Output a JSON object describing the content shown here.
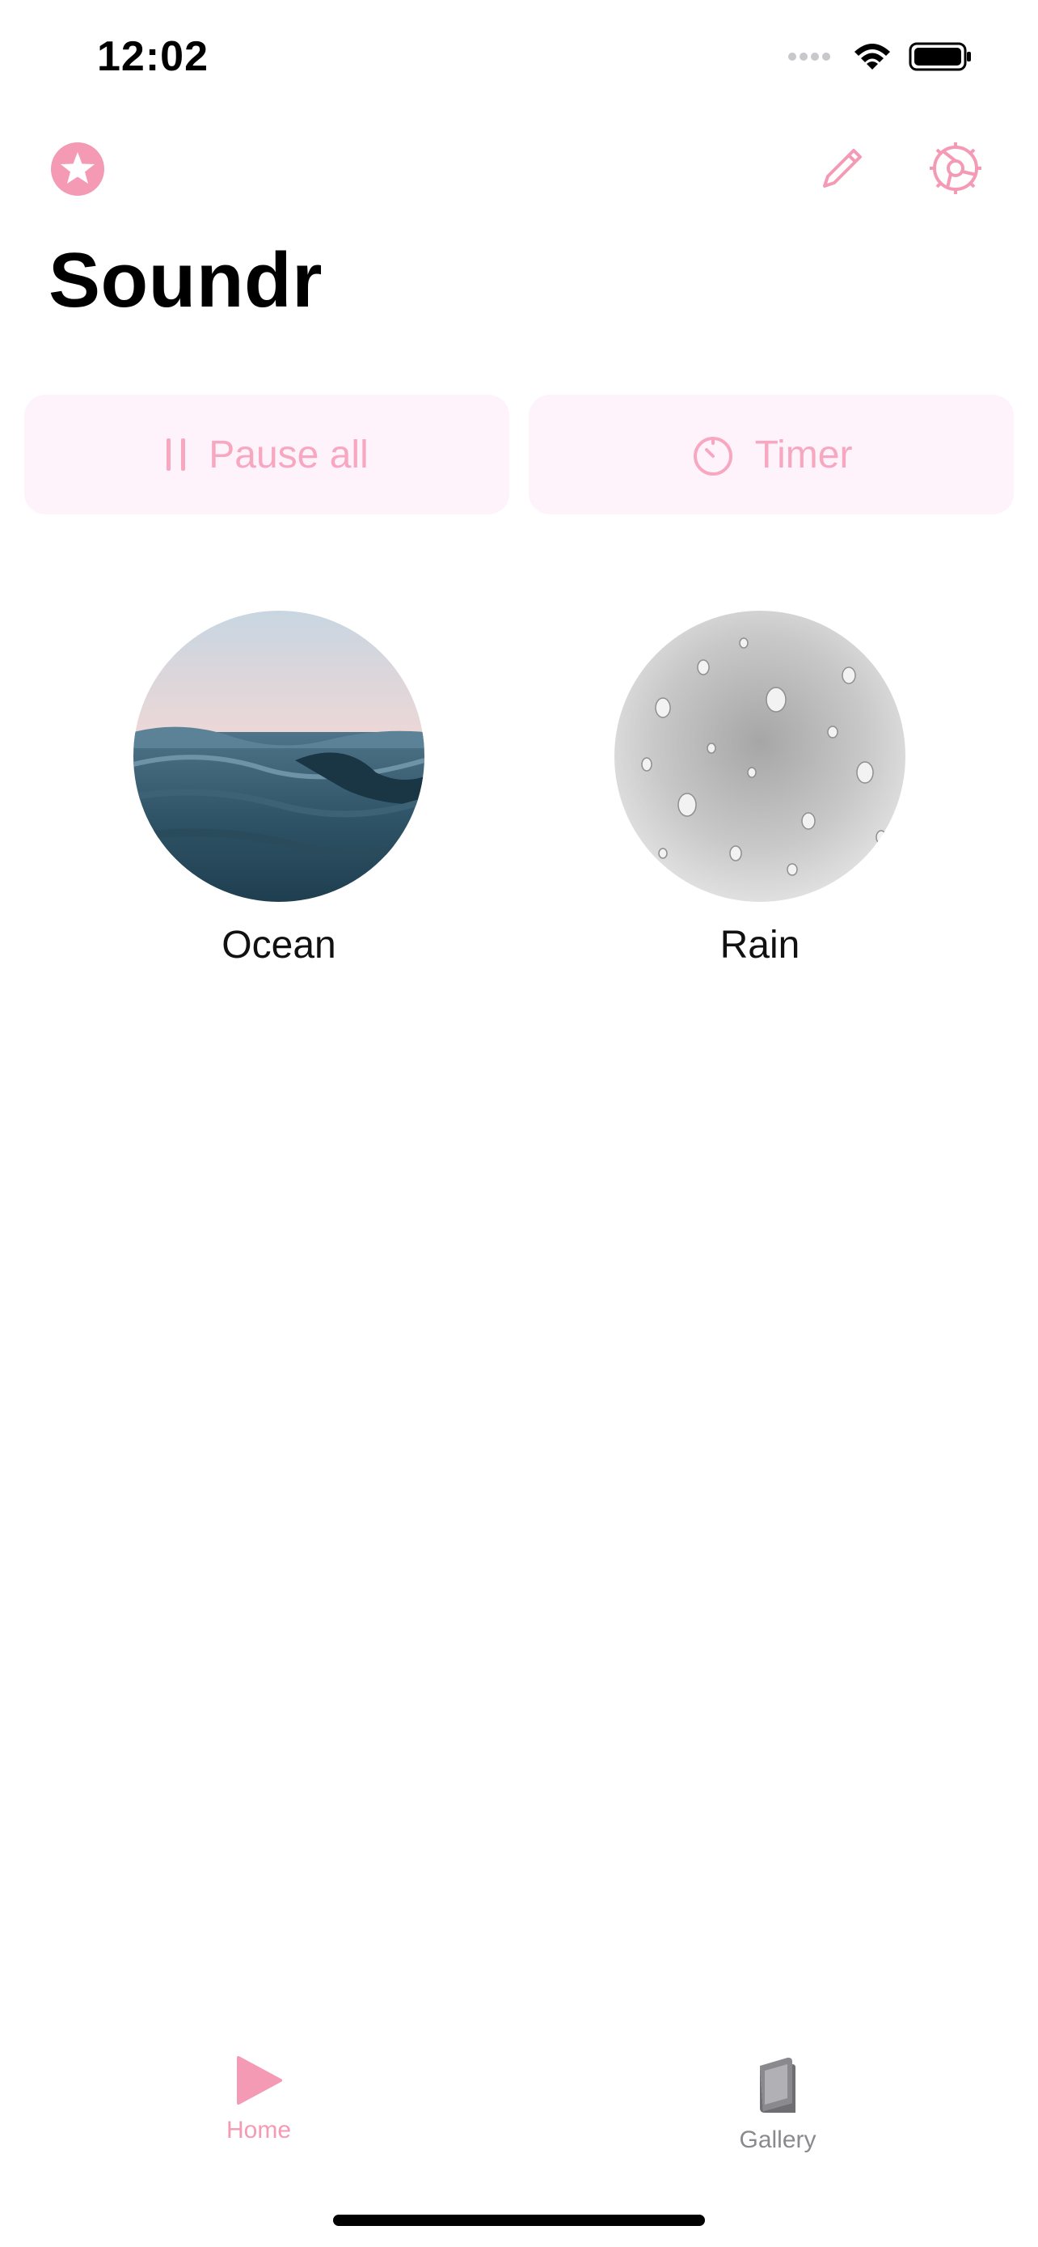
{
  "status_bar": {
    "time": "12:02",
    "icons": [
      "signal-dots-icon",
      "wifi-icon",
      "battery-icon"
    ]
  },
  "header": {
    "title": "Soundr",
    "left_icon": "star-badge-icon",
    "right_icons": [
      "pencil-icon",
      "gear-icon"
    ]
  },
  "actions": {
    "pause_label": "Pause all",
    "timer_label": "Timer"
  },
  "sounds": [
    {
      "label": "Ocean"
    },
    {
      "label": "Rain"
    }
  ],
  "tab_bar": {
    "home_label": "Home",
    "gallery_label": "Gallery"
  },
  "colors": {
    "accent": "#f49ab5",
    "button_bg": "#fff3fb",
    "inactive": "#8a8a8e"
  }
}
